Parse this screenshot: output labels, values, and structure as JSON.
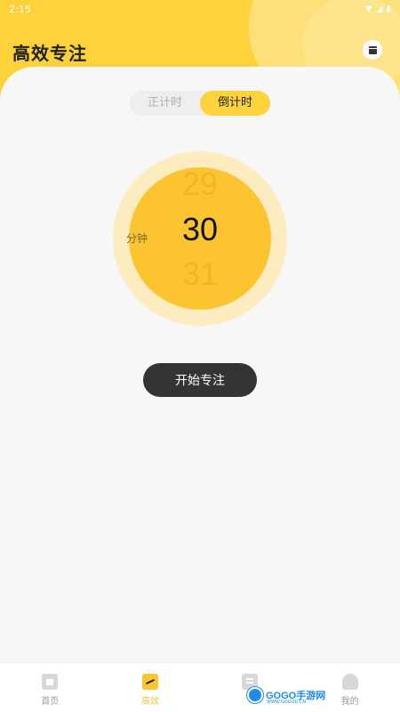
{
  "status_bar": {
    "time": "2:15"
  },
  "header": {
    "title": "高效专注"
  },
  "mode_toggle": {
    "options": [
      "正计时",
      "倒计时"
    ],
    "selected": "倒计时"
  },
  "timer": {
    "prev": "29",
    "current": "30",
    "next": "31",
    "unit": "分钟"
  },
  "start_button": {
    "label": "开始专注"
  },
  "tabs": [
    {
      "label": "首页",
      "icon": "home-icon",
      "active": false
    },
    {
      "label": "高效",
      "icon": "chart-icon",
      "active": true
    },
    {
      "label": "",
      "icon": "document-icon",
      "active": false
    },
    {
      "label": "我的",
      "icon": "user-icon",
      "active": false
    }
  ],
  "watermark": {
    "text": "GOGO手游网",
    "sub": "WWW.GOGOD.CN"
  },
  "colors": {
    "accent": "#fdd23a",
    "dial": "#fdc431",
    "ring": "#fdecc0",
    "button": "#343434"
  }
}
